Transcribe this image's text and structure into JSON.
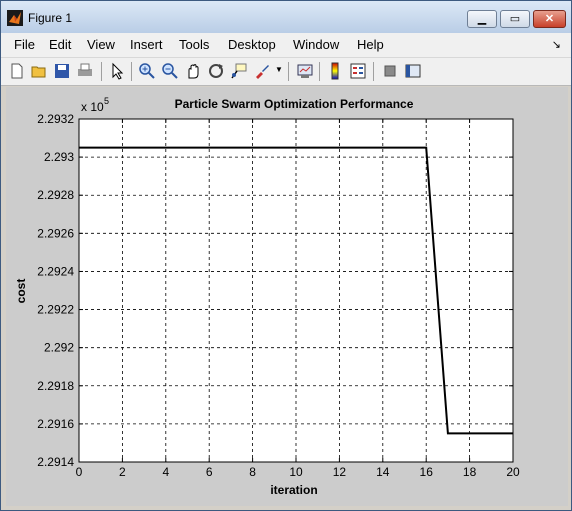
{
  "window": {
    "title": "Figure 1"
  },
  "menu": {
    "items": [
      "File",
      "Edit",
      "View",
      "Insert",
      "Tools",
      "Desktop",
      "Window",
      "Help"
    ]
  },
  "toolbar": {
    "icons": [
      "new-figure-icon",
      "open-file-icon",
      "save-icon",
      "print-icon",
      "pointer-icon",
      "zoom-in-icon",
      "zoom-out-icon",
      "pan-icon",
      "rotate-icon",
      "data-cursor-icon",
      "brush-icon",
      "link-plot-icon",
      "colorbar-icon",
      "legend-icon",
      "hide-plot-tools-icon",
      "show-plot-tools-icon"
    ]
  },
  "chart_data": {
    "type": "line",
    "title": "Particle Swarm Optimization Performance",
    "xlabel": "iteration",
    "ylabel": "cost",
    "y_exponent_label": "x 10",
    "y_exponent": "5",
    "xlim": [
      0,
      20
    ],
    "ylim": [
      2.2914,
      2.2932
    ],
    "x_ticks": [
      "0",
      "2",
      "4",
      "6",
      "8",
      "10",
      "12",
      "14",
      "16",
      "18",
      "20"
    ],
    "y_ticks": [
      "2.2914",
      "2.2916",
      "2.2918",
      "2.292",
      "2.2922",
      "2.2924",
      "2.2926",
      "2.2928",
      "2.293",
      "2.2932"
    ],
    "grid": true,
    "series": [
      {
        "x": [
          0,
          1,
          2,
          3,
          4,
          5,
          6,
          7,
          8,
          9,
          10,
          11,
          12,
          13,
          14,
          15,
          16,
          17,
          18,
          19,
          20
        ],
        "y": [
          2.29305,
          2.29305,
          2.29305,
          2.29305,
          2.29305,
          2.29305,
          2.29305,
          2.29305,
          2.29305,
          2.29305,
          2.29305,
          2.29305,
          2.29305,
          2.29305,
          2.29305,
          2.29305,
          2.29305,
          2.29155,
          2.29155,
          2.29155,
          2.29155
        ],
        "color": "#000000"
      }
    ]
  }
}
